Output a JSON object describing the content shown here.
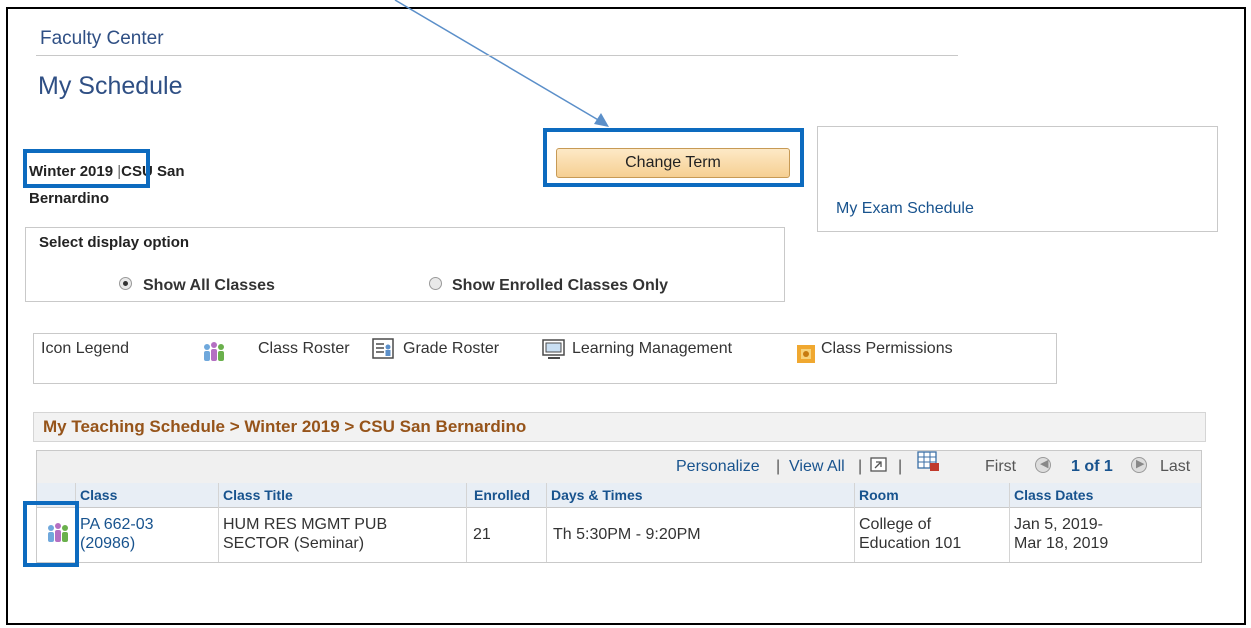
{
  "header": {
    "breadcrumb": "Faculty Center",
    "title": "My Schedule"
  },
  "term": {
    "term_name": "Winter 2019",
    "institution_line1": "CSU San",
    "institution_line2": "Bernardino",
    "separator": "|"
  },
  "change_term_button": "Change Term",
  "exam_schedule_link": "My Exam Schedule",
  "display_option": {
    "label": "Select display option",
    "options": [
      {
        "label": "Show All Classes",
        "selected": true
      },
      {
        "label": "Show Enrolled Classes Only",
        "selected": false
      }
    ]
  },
  "icon_legend": {
    "label": "Icon Legend",
    "items": [
      "Class Roster",
      "Grade Roster",
      "Learning Management",
      "Class Permissions"
    ]
  },
  "schedule": {
    "heading": "My Teaching Schedule > Winter 2019 > CSU San Bernardino",
    "nav": {
      "personalize": "Personalize",
      "view_all": "View All",
      "first": "First",
      "page": "1 of 1",
      "last": "Last"
    },
    "columns": [
      "Class",
      "Class Title",
      "Enrolled",
      "Days & Times",
      "Room",
      "Class Dates"
    ],
    "rows": [
      {
        "class_line1": "PA 662-03",
        "class_line2": "(20986)",
        "title_line1": "HUM RES MGMT PUB",
        "title_line2": "SECTOR (Seminar)",
        "enrolled": "21",
        "days_times": "Th 5:30PM - 9:20PM",
        "room_line1": "College of",
        "room_line2": "Education 101",
        "dates_line1": "Jan 5, 2019-",
        "dates_line2": "Mar 18, 2019"
      }
    ]
  },
  "colors": {
    "highlight": "#0d6bbf",
    "link": "#18538e",
    "heading": "#96541a",
    "title": "#2f4f84",
    "button": "#f6cf92"
  }
}
